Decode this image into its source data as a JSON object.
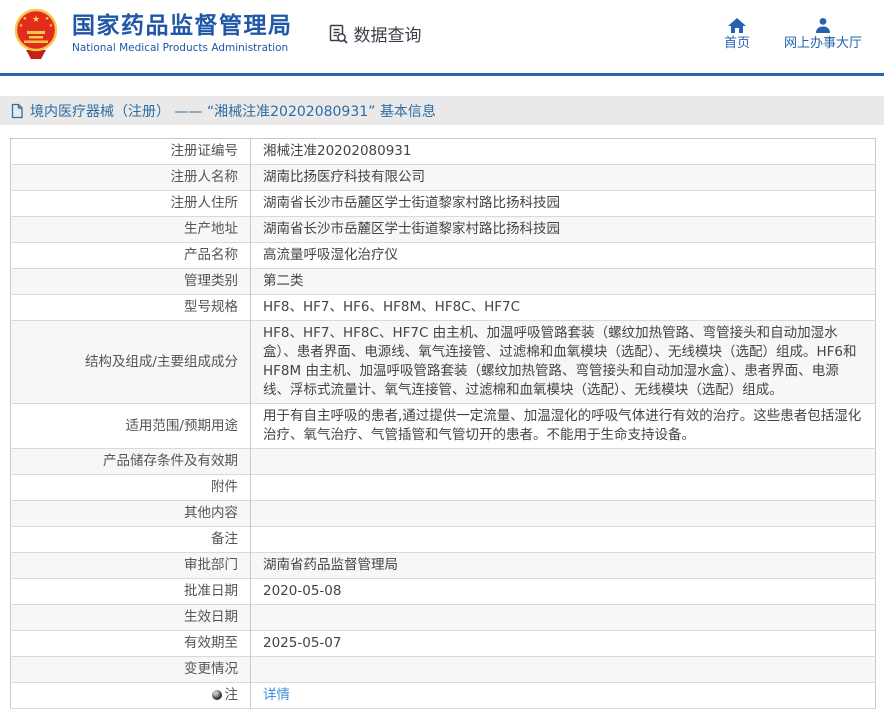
{
  "header": {
    "org_name_cn": "国家药品监督管理局",
    "org_name_en": "National Medical Products Administration",
    "data_query_label": "数据查询",
    "nav": [
      {
        "label": "首页",
        "icon": "home-icon"
      },
      {
        "label": "网上办事大厅",
        "icon": "user-icon"
      }
    ]
  },
  "breadcrumb": {
    "text": "境内医疗器械（注册） —— “湘械注准20202080931” 基本信息"
  },
  "table": {
    "rows": [
      {
        "label": "注册证编号",
        "value": "湘械注准20202080931"
      },
      {
        "label": "注册人名称",
        "value": "湖南比扬医疗科技有限公司"
      },
      {
        "label": "注册人住所",
        "value": "湖南省长沙市岳麓区学士街道黎家村路比扬科技园"
      },
      {
        "label": "生产地址",
        "value": "湖南省长沙市岳麓区学士街道黎家村路比扬科技园"
      },
      {
        "label": "产品名称",
        "value": "高流量呼吸湿化治疗仪"
      },
      {
        "label": "管理类别",
        "value": "第二类"
      },
      {
        "label": "型号规格",
        "value": "HF8、HF7、HF6、HF8M、HF8C、HF7C"
      },
      {
        "label": "结构及组成/主要组成成分",
        "value": "HF8、HF7、HF8C、HF7C 由主机、加温呼吸管路套装（螺纹加热管路、弯管接头和自动加湿水盒）、患者界面、电源线、氧气连接管、过滤棉和血氧模块（选配）、无线模块（选配）组成。HF6和HF8M 由主机、加温呼吸管路套装（螺纹加热管路、弯管接头和自动加湿水盒）、患者界面、电源线、浮标式流量计、氧气连接管、过滤棉和血氧模块（选配）、无线模块（选配）组成。"
      },
      {
        "label": "适用范围/预期用途",
        "value": "用于有自主呼吸的患者,通过提供一定流量、加温湿化的呼吸气体进行有效的治疗。这些患者包括湿化治疗、氧气治疗、气管插管和气管切开的患者。不能用于生命支持设备。"
      },
      {
        "label": "产品储存条件及有效期",
        "value": ""
      },
      {
        "label": "附件",
        "value": ""
      },
      {
        "label": "其他内容",
        "value": ""
      },
      {
        "label": "备注",
        "value": ""
      },
      {
        "label": "审批部门",
        "value": "湖南省药品监督管理局"
      },
      {
        "label": "批准日期",
        "value": "2020-05-08"
      },
      {
        "label": "生效日期",
        "value": ""
      },
      {
        "label": "有效期至",
        "value": "2025-05-07"
      },
      {
        "label": "变更情况",
        "value": ""
      },
      {
        "label": "注",
        "value": "详情",
        "value_is_link": true,
        "label_icon": "note-icon"
      }
    ]
  },
  "colors": {
    "brand_blue": "#2057a7",
    "nav_blue": "#2563ae",
    "header_border_blue": "#2268a8",
    "breadcrumb_bg": "#e9e9e9",
    "breadcrumb_text": "#2e6da4",
    "link_blue": "#3d8fdb",
    "emblem_red": "#e02b1d",
    "emblem_gold": "#f6c64b",
    "row_stripe": "#f7f7f7"
  }
}
